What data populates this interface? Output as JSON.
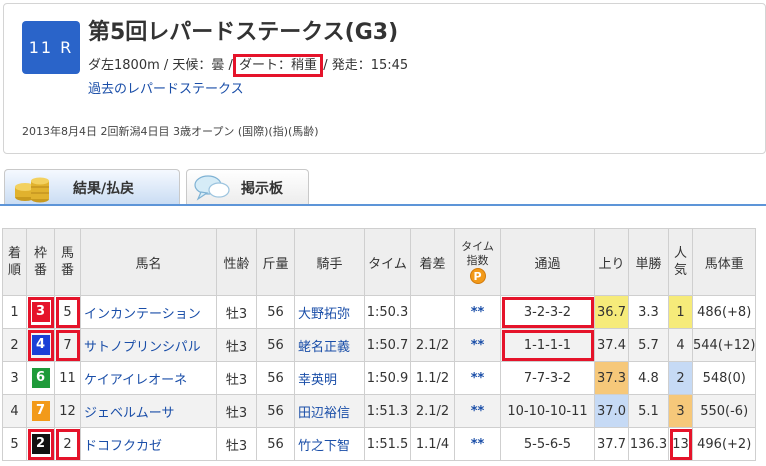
{
  "race": {
    "number": "11 R",
    "title": "第5回レパードステークス(G3)",
    "info_prefix": "ダ左1800m / 天候：曇 / ",
    "track_condition": "ダート：稍重",
    "info_suffix": " / 発走：15:45",
    "past_link": "過去のレパードステークス",
    "date_line": "2013年8月4日 2回新潟4日目 3歳オープン (国際)(指)(馬齢)"
  },
  "tabs": [
    {
      "label": "結果/払戻",
      "icon": "coin-stack-icon",
      "active": true
    },
    {
      "label": "掲示板",
      "icon": "speech-bubble-icon",
      "active": false
    }
  ],
  "table": {
    "headers": {
      "rank": "着順",
      "waku": "枠番",
      "umaban": "馬番",
      "horse": "馬名",
      "sex_age": "性齢",
      "weight": "斤量",
      "jockey": "騎手",
      "time": "タイム",
      "margin": "着差",
      "time_index_1": "タイム",
      "time_index_2": "指数",
      "time_index_badge": "P",
      "passing": "通過",
      "last3f": "上り",
      "odds": "単勝",
      "popularity": "人気",
      "body_weight": "馬体重"
    },
    "rows": [
      {
        "rank": "1",
        "waku": "3",
        "waku_color": "#e5132a",
        "waku_text": "#ffffff",
        "umaban": "5",
        "horse": "インカンテーション",
        "sex_age": "牡3",
        "weight": "56",
        "jockey": "大野拓弥",
        "time": "1:50.3",
        "margin": "",
        "time_index": "**",
        "passing": "3-2-3-2",
        "last3f": "36.7",
        "odds": "3.3",
        "popularity": "1",
        "body_weight": "486(+8)"
      },
      {
        "rank": "2",
        "waku": "4",
        "waku_color": "#1a3fd6",
        "waku_text": "#ffffff",
        "umaban": "7",
        "horse": "サトノプリンシパル",
        "sex_age": "牡3",
        "weight": "56",
        "jockey": "蛯名正義",
        "time": "1:50.7",
        "margin": "2.1/2",
        "time_index": "**",
        "passing": "1-1-1-1",
        "last3f": "37.4",
        "odds": "5.7",
        "popularity": "4",
        "body_weight": "544(+12)"
      },
      {
        "rank": "3",
        "waku": "6",
        "waku_color": "#1e9b3a",
        "waku_text": "#ffffff",
        "umaban": "11",
        "horse": "ケイアイレオーネ",
        "sex_age": "牡3",
        "weight": "56",
        "jockey": "幸英明",
        "time": "1:50.9",
        "margin": "1.1/2",
        "time_index": "**",
        "passing": "7-7-3-2",
        "last3f": "37.3",
        "odds": "4.8",
        "popularity": "2",
        "body_weight": "548(0)"
      },
      {
        "rank": "4",
        "waku": "7",
        "waku_color": "#f29a1a",
        "waku_text": "#ffffff",
        "umaban": "12",
        "horse": "ジェベルムーサ",
        "sex_age": "牡3",
        "weight": "56",
        "jockey": "田辺裕信",
        "time": "1:51.3",
        "margin": "2.1/2",
        "time_index": "**",
        "passing": "10-10-10-11",
        "last3f": "37.0",
        "odds": "5.1",
        "popularity": "3",
        "body_weight": "550(-6)"
      },
      {
        "rank": "5",
        "waku": "2",
        "waku_color": "#111111",
        "waku_text": "#ffffff",
        "umaban": "2",
        "horse": "ドコフクカゼ",
        "sex_age": "牡3",
        "weight": "56",
        "jockey": "竹之下智",
        "time": "1:51.5",
        "margin": "1.1/4",
        "time_index": "**",
        "passing": "5-5-6-5",
        "last3f": "37.7",
        "odds": "136.3",
        "popularity": "13",
        "body_weight": "496(+2)"
      }
    ]
  },
  "colors": {
    "highlight_red": "#e5132a",
    "link_blue": "#1a4ea8",
    "badge_blue": "#2a64c9",
    "rank1_yellow": "#f6eb7a",
    "rank2_blue": "#c6daf5",
    "rank3_orange": "#f6c87a"
  }
}
